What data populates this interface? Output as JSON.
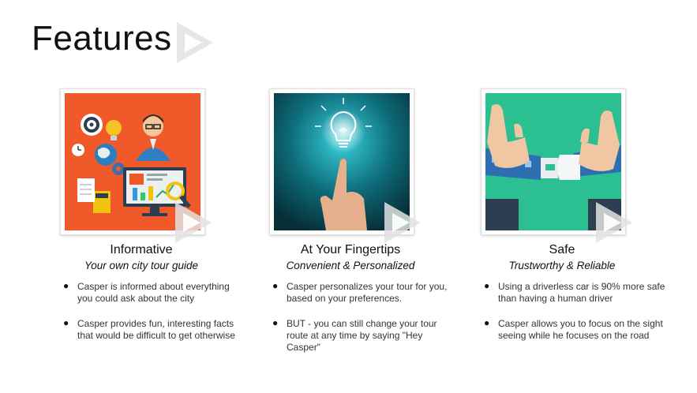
{
  "page": {
    "title": "Features"
  },
  "cards": [
    {
      "title": "Informative",
      "subtitle": "Your own city tour guide",
      "image_icon": "tour-guide-illustration",
      "bullets": [
        "Casper is informed about everything you could ask about the city",
        "Casper provides fun, interesting facts that would be difficult to get otherwise"
      ]
    },
    {
      "title": "At Your Fingertips",
      "subtitle": "Convenient & Personalized",
      "image_icon": "lightbulb-finger-illustration",
      "bullets": [
        "Casper personalizes your tour for you, based on your preferences.",
        "BUT - you can still change your tour route at any time by saying \"Hey Casper\""
      ]
    },
    {
      "title": "Safe",
      "subtitle": "Trustworthy & Reliable",
      "image_icon": "seatbelt-buckle-illustration",
      "bullets": [
        "Using a driverless car is 90% more safe than having a human driver",
        "Casper allows you to focus on the sight seeing while he focuses on the road"
      ]
    }
  ],
  "colors": {
    "card1_bg": "#f05a2a",
    "card2_bg": "#0e7680",
    "card3_bg": "#2bbf92"
  }
}
